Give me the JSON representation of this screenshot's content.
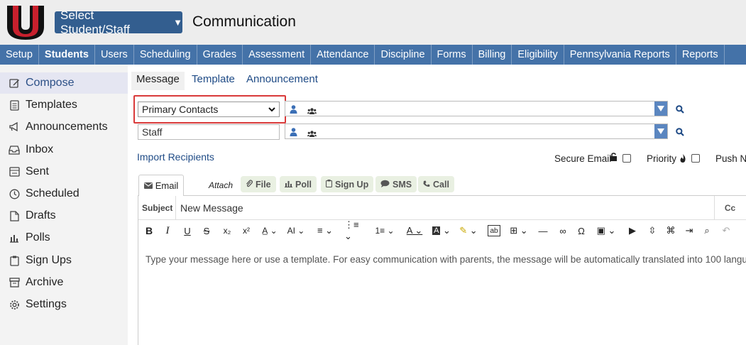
{
  "header": {
    "student_button": "Select Student/Staff",
    "page_title": "Communication"
  },
  "nav": [
    "Setup",
    "Students",
    "Users",
    "Scheduling",
    "Grades",
    "Assessment",
    "Attendance",
    "Discipline",
    "Forms",
    "Billing",
    "Eligibility",
    "Pennsylvania Reports",
    "Reports"
  ],
  "nav_active": "Students",
  "sidebar": [
    {
      "label": "Compose",
      "icon": "edit-icon",
      "active": true
    },
    {
      "label": "Templates",
      "icon": "document-icon"
    },
    {
      "label": "Announcements",
      "icon": "megaphone-icon"
    },
    {
      "label": "Inbox",
      "icon": "inbox-icon"
    },
    {
      "label": "Sent",
      "icon": "sent-tray-icon"
    },
    {
      "label": "Scheduled",
      "icon": "clock-icon"
    },
    {
      "label": "Drafts",
      "icon": "drafts-icon"
    },
    {
      "label": "Polls",
      "icon": "bar-chart-icon"
    },
    {
      "label": "Sign Ups",
      "icon": "clipboard-icon"
    },
    {
      "label": "Archive",
      "icon": "archive-icon"
    },
    {
      "label": "Settings",
      "icon": "gear-icon"
    }
  ],
  "tabs": [
    "Message",
    "Template",
    "Announcement"
  ],
  "recipients": {
    "contacts_select": "Primary Contacts",
    "staff_field": "Staff"
  },
  "import_link": "Import Recipients",
  "options": {
    "secure_email": "Secure Email",
    "priority": "Priority",
    "push": "Push No"
  },
  "editor": {
    "email_tab": "Email",
    "attach_label": "Attach",
    "attach_buttons": [
      "File",
      "Poll",
      "Sign Up",
      "SMS",
      "Call"
    ],
    "subject_label": "Subject",
    "subject_value": "New Message",
    "cc_label": "Cc",
    "body_placeholder": "Type your message here or use a template. For easy communication with parents, the message will be automatically translated into 100 langu"
  },
  "colors": {
    "nav": "#4472a8",
    "button": "#335e8f",
    "highlight": "#d93a3a",
    "link": "#1f4b86"
  }
}
